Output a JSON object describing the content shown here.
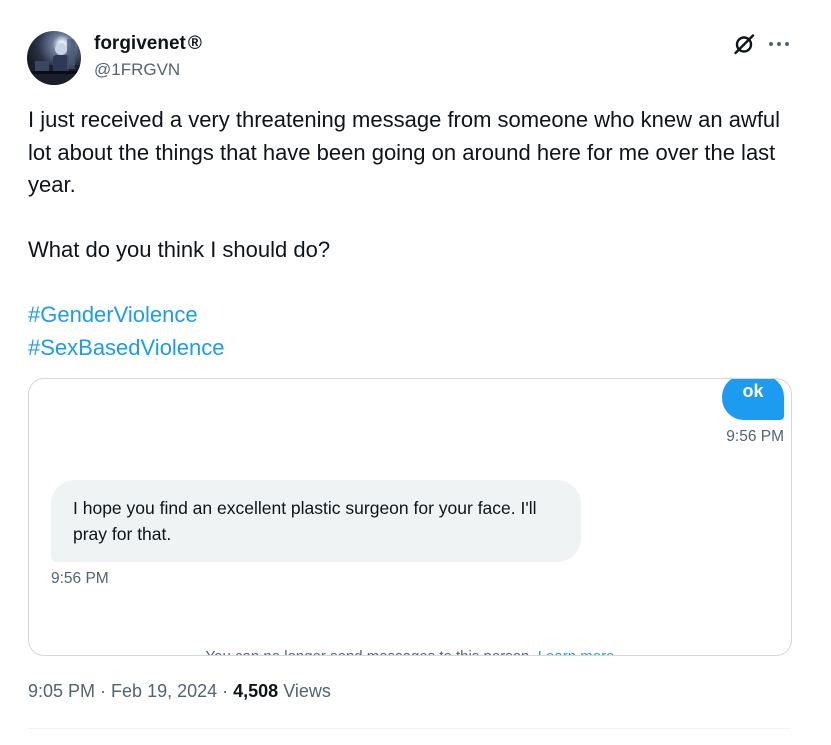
{
  "author": {
    "display_name": "forgivenet",
    "badge": "®",
    "handle": "@1FRGVN"
  },
  "header": {
    "icons": [
      "grok-icon",
      "more-icon"
    ]
  },
  "tweet": {
    "paragraph_1": "I just received a very threatening message from someone who knew an awful lot about the things that have been going on around here for me over the last year.",
    "paragraph_2": "What do you think I should do?",
    "hashtags": [
      "#GenderViolence",
      "#SexBasedViolence"
    ]
  },
  "media": {
    "outgoing_message": "ok",
    "outgoing_time": "9:56 PM",
    "incoming_message": "I hope you find an excellent plastic surgeon for your face. I'll pray for that.",
    "incoming_time": "9:56 PM",
    "notice_text": "You can no longer send messages to this person.",
    "notice_link": "Learn more"
  },
  "meta": {
    "time": "9:05 PM",
    "separator": " · ",
    "date": "Feb 19, 2024",
    "views_count": "4,508",
    "views_label": "Views"
  },
  "colors": {
    "link": "#1d9bf0",
    "secondary_text": "#536471",
    "primary_text": "#0f1419",
    "border": "#cfd9de"
  }
}
